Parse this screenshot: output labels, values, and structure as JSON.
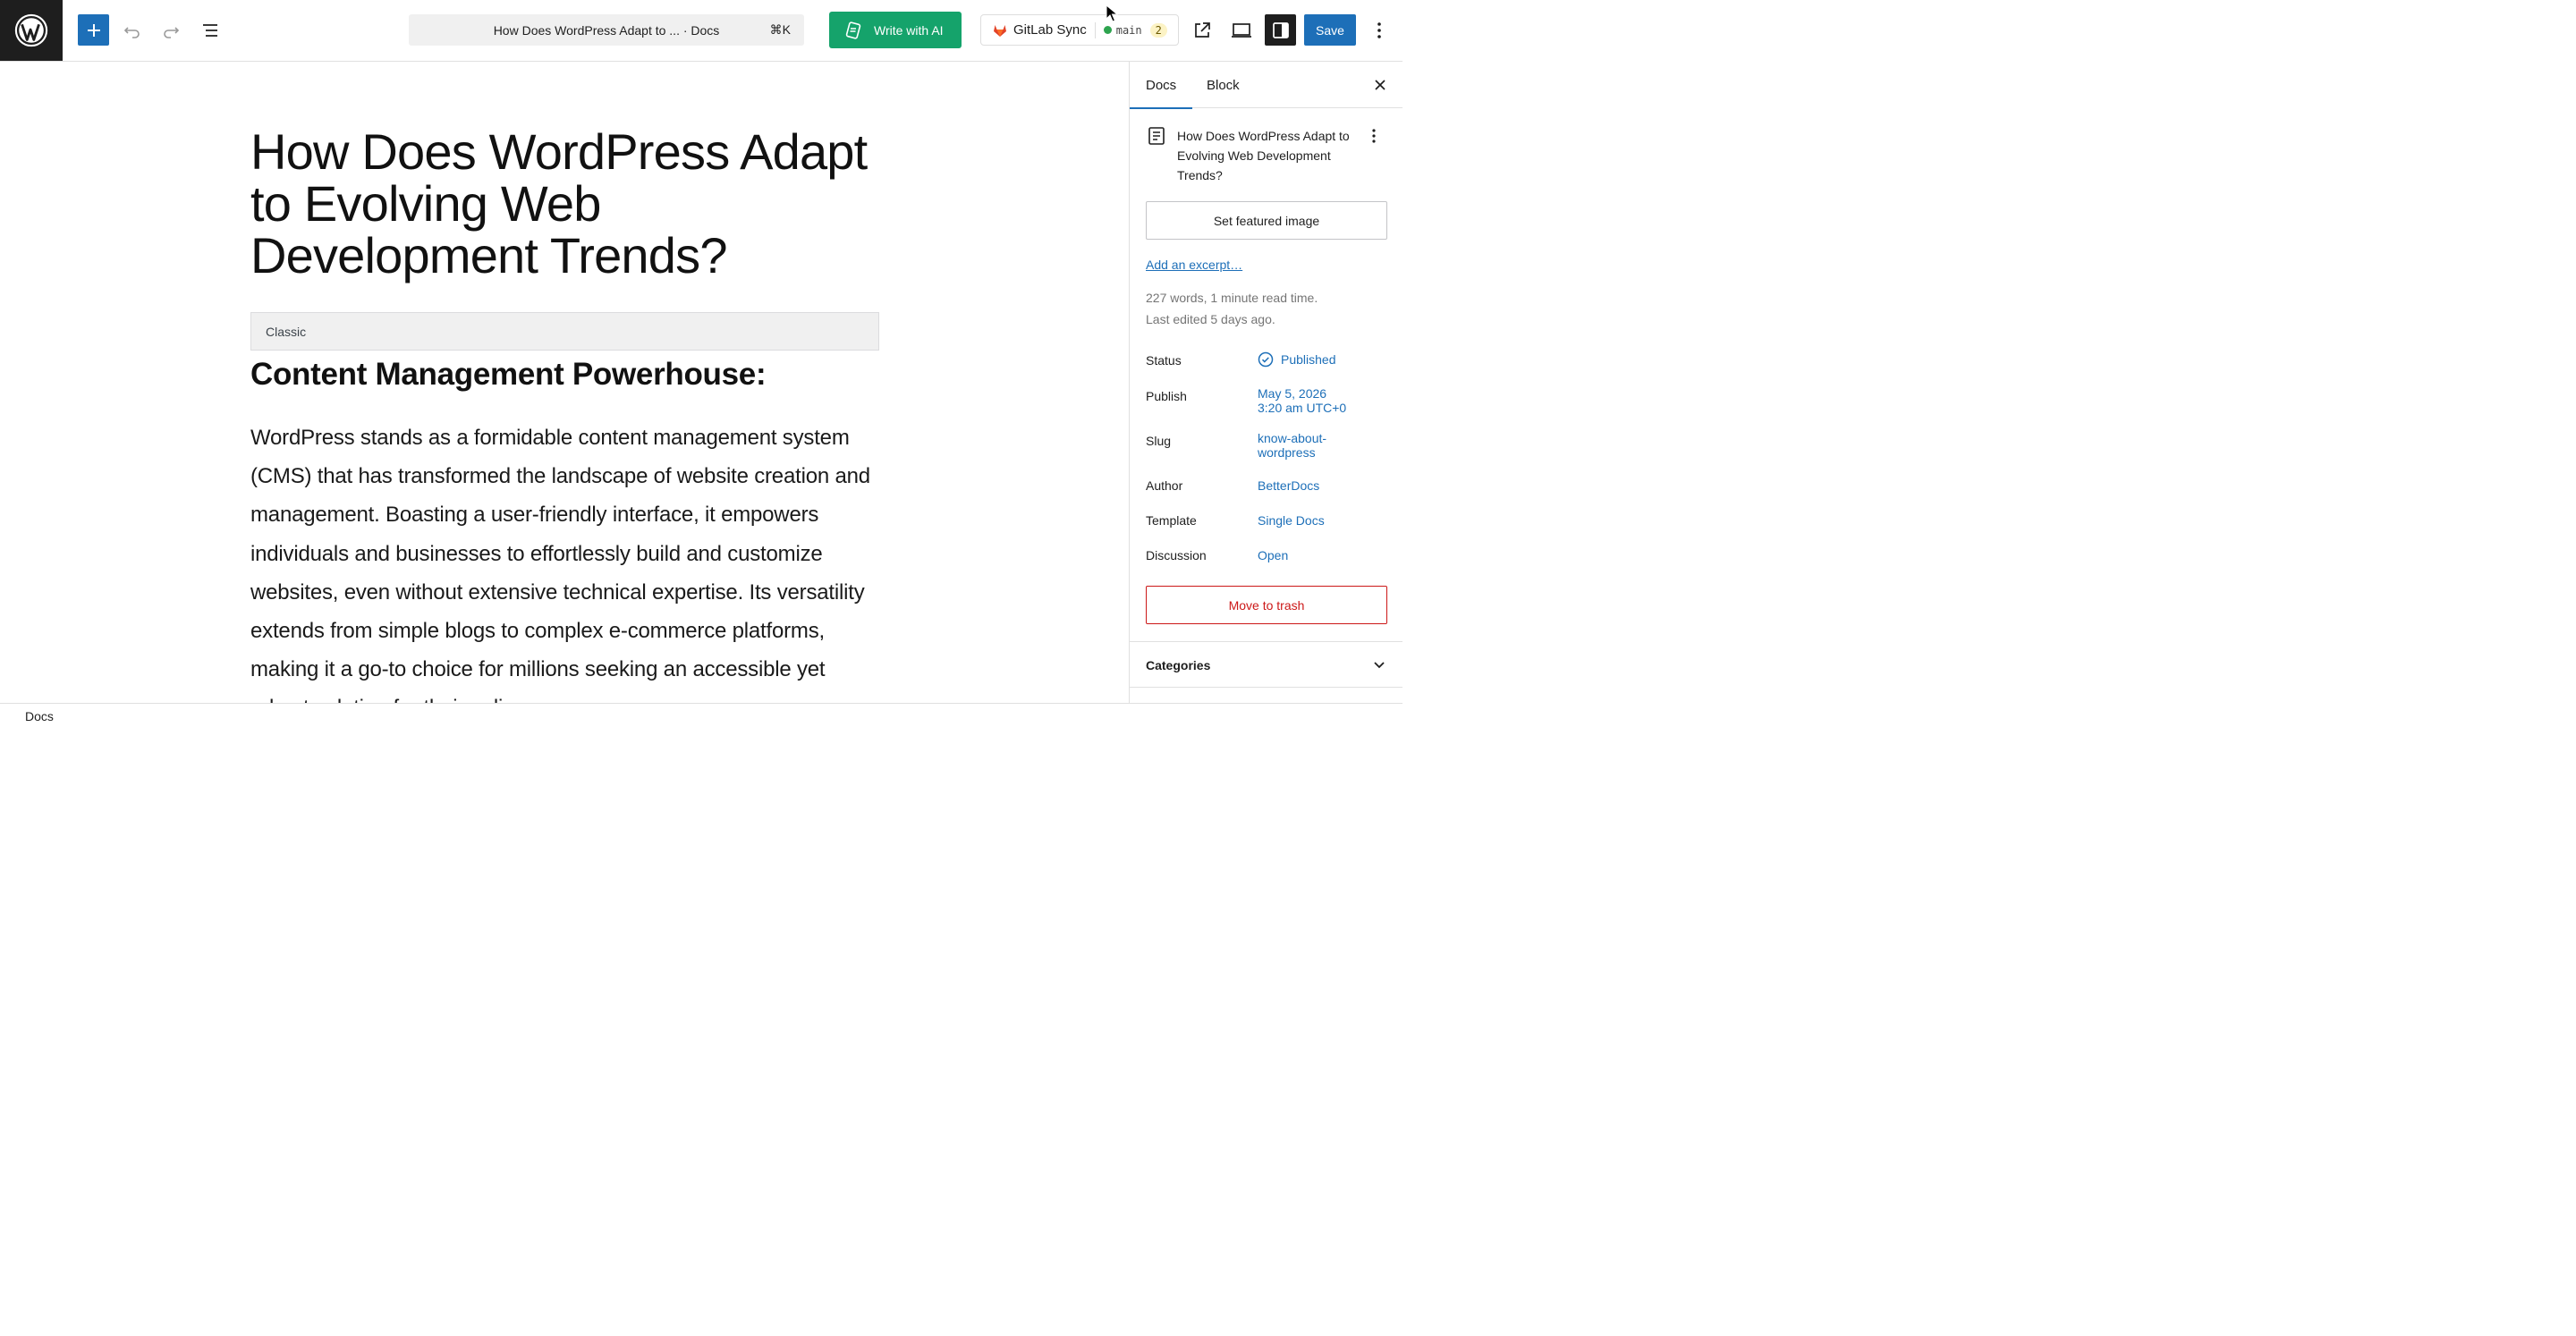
{
  "toolbar": {
    "command_title": "How Does WordPress Adapt to ... · Docs",
    "command_shortcut": "⌘K",
    "ai_label": "Write with AI",
    "gitlab_label": "GitLab Sync",
    "branch": "main",
    "branch_count": "2",
    "save_label": "Save"
  },
  "editor": {
    "title": "How Does WordPress Adapt to Evolving Web Development Trends?",
    "classic_label": "Classic",
    "heading": "Content Management Powerhouse:",
    "paragraph": "WordPress stands as a formidable content management system (CMS) that has transformed the landscape of website creation and management. Boasting a user-friendly interface, it empowers individuals and businesses to effortlessly build and customize websites, even without extensive technical expertise. Its versatility extends from simple blogs to complex e-commerce platforms, making it a go-to choice for millions seeking an accessible yet robust solution for their online presence."
  },
  "sidebar": {
    "tabs": [
      {
        "label": "Docs"
      },
      {
        "label": "Block"
      }
    ],
    "doc_title": "How Does WordPress Adapt to Evolving Web Development Trends?",
    "featured_image": "Set featured image",
    "excerpt": "Add an excerpt…",
    "word_count": "227 words, 1 minute read time.",
    "last_edited": "Last edited 5 days ago.",
    "rows": {
      "status": {
        "label": "Status",
        "value": "Published"
      },
      "publish": {
        "label": "Publish",
        "value_line1": "May 5, 2026",
        "value_line2": "3:20 am UTC+0"
      },
      "slug": {
        "label": "Slug",
        "value_line1": "know-about-",
        "value_line2": "wordpress"
      },
      "author": {
        "label": "Author",
        "value": "BetterDocs"
      },
      "template": {
        "label": "Template",
        "value": "Single Docs"
      },
      "discussion": {
        "label": "Discussion",
        "value": "Open"
      }
    },
    "trash": "Move to trash",
    "categories": "Categories"
  },
  "footer": {
    "breadcrumb": "Docs"
  },
  "colors": {
    "accent": "#1d6fb8",
    "ai_green": "#15a36b",
    "danger": "#cc1818"
  }
}
